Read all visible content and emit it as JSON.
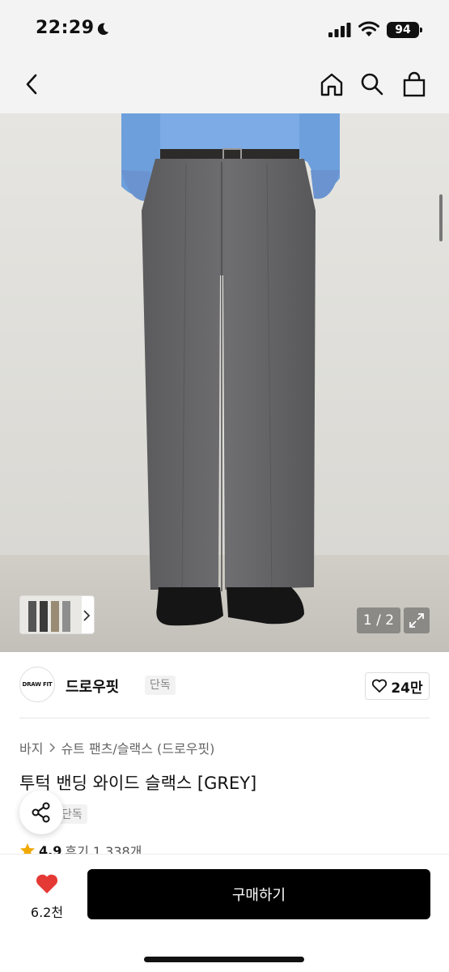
{
  "status_bar": {
    "time": "22:29",
    "battery": "94"
  },
  "nav": {
    "icons": [
      "chevron-left-icon",
      "home-icon",
      "search-icon",
      "shopping-bag-icon"
    ]
  },
  "gallery": {
    "counter": "1 / 2"
  },
  "brand": {
    "logo_text": "DRAW FIT",
    "name": "드로우핏",
    "exclusive_label": "단독",
    "like_count": "24만"
  },
  "breadcrumb": {
    "category": "바지",
    "subcategory": "슈트 팬츠/슬랙스 (드로우핏)"
  },
  "product": {
    "title": "투턱 밴딩 와이드 슬랙스 [GREY]",
    "sub_tag": "단독",
    "rating": "4.9",
    "reviews": "후기 1,338개"
  },
  "bottom_bar": {
    "wish_count": "6.2천",
    "buy_label": "구매하기"
  },
  "colors": {
    "heart": "#e53935",
    "buy_button": "#000000",
    "star": "#f2a900"
  }
}
